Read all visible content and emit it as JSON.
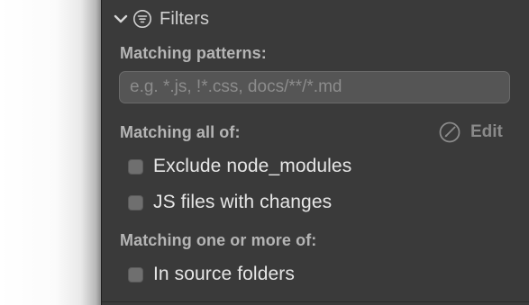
{
  "filters": {
    "title": "Filters",
    "icons": {
      "collapse": "chevron-down-icon",
      "filter": "filter-lines-icon",
      "edit": "pencil-circle-icon"
    },
    "matching_patterns": {
      "label": "Matching patterns:",
      "value": "",
      "placeholder": "e.g. *.js, !*.css, docs/**/*.md"
    },
    "matching_all": {
      "label": "Matching all of:",
      "edit_label": "Edit",
      "items": [
        {
          "label": "Exclude node_modules",
          "checked": false
        },
        {
          "label": "JS files with changes",
          "checked": false
        }
      ]
    },
    "matching_any": {
      "label": "Matching one or more of:",
      "items": [
        {
          "label": "In source folders",
          "checked": false
        }
      ]
    }
  },
  "colors": {
    "panel_background": "#3a3a3a",
    "input_background": "#555555",
    "checkbox_fill": "#6f6f6f",
    "section_label": "#b5b5b5",
    "muted_edit": "#8a8a8a",
    "text": "#e6e6e6"
  }
}
